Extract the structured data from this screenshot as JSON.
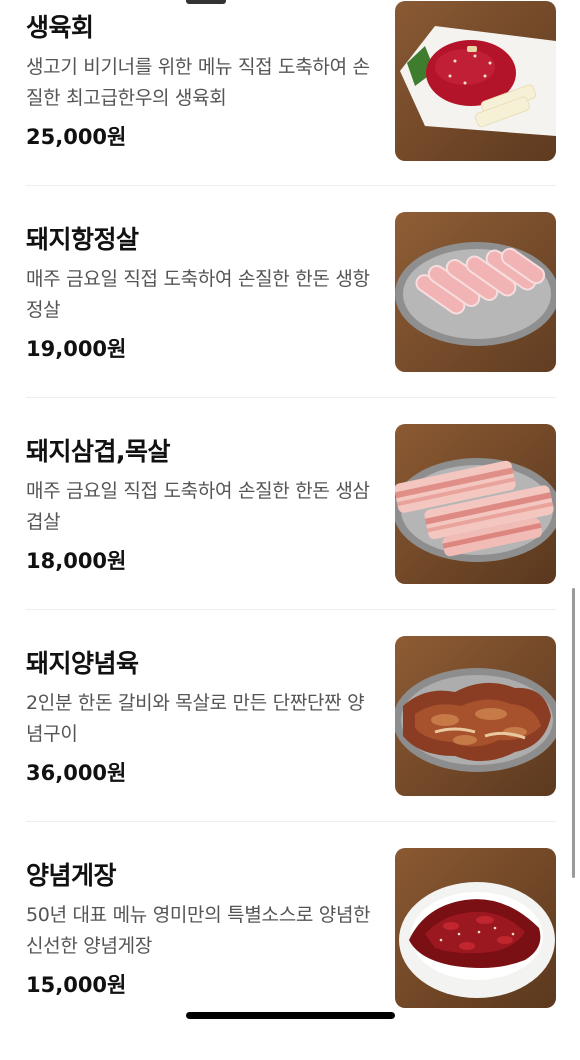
{
  "menu_items": [
    {
      "name": "생육회",
      "description": "생고기 비기너를 위한 메뉴 직접 도축하여 손질한 최고급한우의 생육회",
      "price": "25,000원",
      "image": "beef-tartare-photo"
    },
    {
      "name": "돼지항정살",
      "description": "매주 금요일 직접 도축하여 손질한 한돈 생항정살",
      "price": "19,000원",
      "image": "pork-jowl-photo"
    },
    {
      "name": "돼지삼겹,목살",
      "description": "매주 금요일 직접 도축하여 손질한 한돈 생삼겹살",
      "price": "18,000원",
      "image": "pork-belly-photo"
    },
    {
      "name": "돼지양념육",
      "description": "2인분 한돈 갈비와 목살로 만든 단짠단짠 양념구이",
      "price": "36,000원",
      "image": "marinated-pork-photo"
    },
    {
      "name": "양념게장",
      "description": "50년 대표 메뉴 영미만의 특별소스로 양념한 신선한 양념게장",
      "price": "15,000원",
      "image": "seasoned-crab-photo"
    }
  ]
}
